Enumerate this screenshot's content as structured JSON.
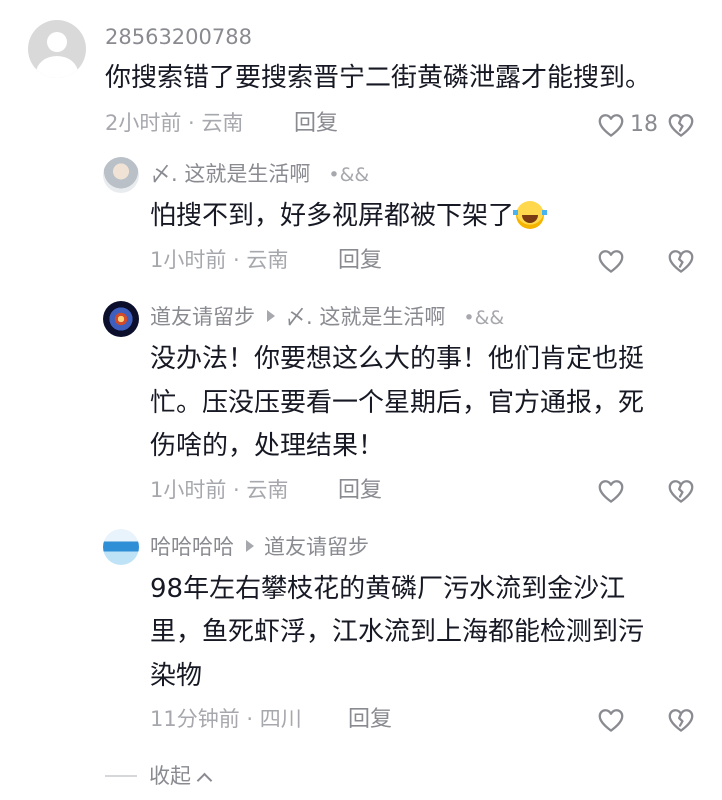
{
  "comments": [
    {
      "username": "28563200788",
      "content_lines": [
        "你搜索错了要搜索晋宁二街黄磷泄露才能搜到。"
      ],
      "meta": "2小时前 · 云南",
      "reply_label": "回复",
      "like_count": "18",
      "avatar": "default-avatar"
    }
  ],
  "replies": [
    {
      "username": "〆. 这就是生活啊",
      "tag": "•&&",
      "content_lines": [
        "怕搜不到，好多视屏都被下架了"
      ],
      "emoji": "rolling-laughing-emoji",
      "meta": "1小时前 · 云南",
      "reply_label": "回复",
      "avatar": "photo-avatar"
    },
    {
      "username": "道友请留步",
      "reply_to": "〆. 这就是生活啊",
      "tag": "•&&",
      "content_lines": [
        "没办法！你要想这么大的事！他们肯定也挺",
        "忙。压没压要看一个星期后，官方通报，死",
        "伤啥的，处理结果！"
      ],
      "meta": "1小时前 · 云南",
      "reply_label": "回复",
      "avatar": "galaxy-avatar"
    },
    {
      "username": "哈哈哈哈",
      "reply_to": "道友请留步",
      "content_lines": [
        "98年左右攀枝花的黄磷厂污水流到金沙江",
        "里，鱼死虾浮，江水流到上海都能检测到污",
        "染物"
      ],
      "meta": "11分钟前 · 四川",
      "reply_label": "回复",
      "avatar": "sea-avatar"
    }
  ],
  "collapse_label": "收起",
  "icons": {
    "like": "heart-icon",
    "dislike": "broken-heart-icon",
    "collapse": "chevron-up-icon"
  },
  "colors": {
    "text": "#161823",
    "secondary": "#8a8b91",
    "tertiary": "#a7a8ad"
  }
}
